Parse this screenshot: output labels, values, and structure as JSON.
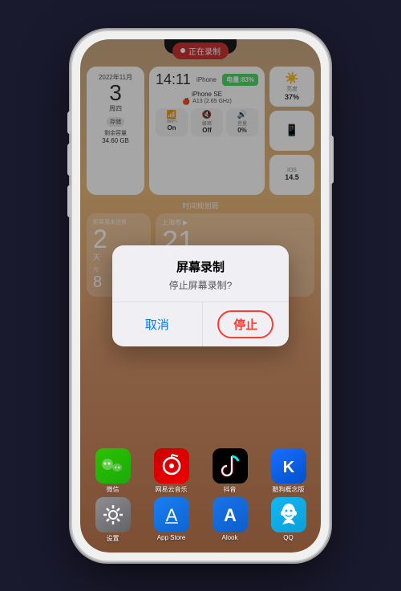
{
  "phone": {
    "recording_bar": "正在录制",
    "notch": true
  },
  "widgets": {
    "date_widget": {
      "month": "2022年11月",
      "day": "3",
      "weekday": "周四",
      "badge": "存储",
      "storage_label": "剩余容量",
      "storage_value": "34.60 GB"
    },
    "sysinfo": {
      "time": "14:11",
      "device": "iPhone",
      "battery": "电量:83%",
      "model_name": "iPhone SE",
      "chip": "A13 (2.65 GHz)",
      "tiles": [
        {
          "icon": "📶",
          "label": "WiFi",
          "value": "On"
        },
        {
          "icon": "🔇",
          "label": "蜂窝",
          "value": "Off"
        },
        {
          "icon": "🔊",
          "label": "音量",
          "value": "0%"
        }
      ]
    },
    "right_col": [
      {
        "icon": "☀️",
        "label": "亮度",
        "value": "37%"
      },
      {
        "icon": "📱",
        "label": "",
        "value": ""
      },
      {
        "icon": "",
        "label": "iOS",
        "value": "14.5"
      }
    ],
    "section_label": "时间规划局",
    "days_widget": {
      "label": "距离周末还有",
      "num": "2",
      "unit": "天",
      "sun_label": "光",
      "sun_num": "8"
    },
    "temp_widget": {
      "city": "上海市",
      "temp": "21"
    }
  },
  "dialog": {
    "title": "屏幕录制",
    "message": "停止屏幕录制?",
    "cancel_label": "取消",
    "stop_label": "停止"
  },
  "apps": {
    "row1": [
      {
        "name": "微信",
        "icon": "wechat"
      },
      {
        "name": "网易云音乐",
        "icon": "netease"
      },
      {
        "name": "抖音",
        "icon": "tiktok"
      },
      {
        "name": "酷狗概念版",
        "icon": "kudog"
      }
    ],
    "row2": [
      {
        "name": "设置",
        "icon": "settings"
      },
      {
        "name": "App Store",
        "icon": "appstore"
      },
      {
        "name": "Alook",
        "icon": "alook"
      },
      {
        "name": "QQ",
        "icon": "qq"
      }
    ]
  }
}
